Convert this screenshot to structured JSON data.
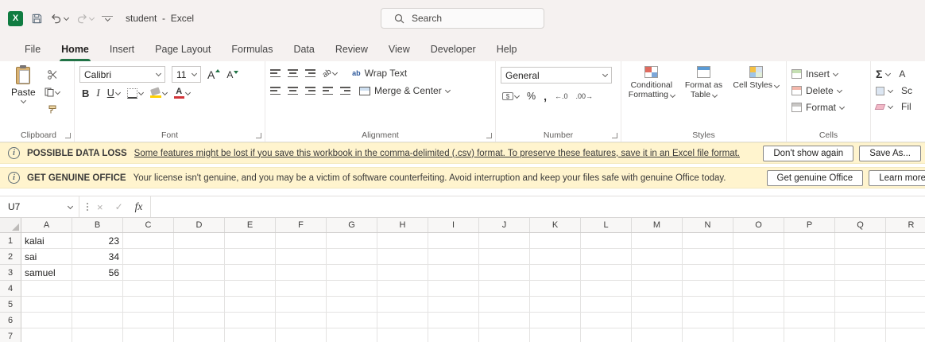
{
  "titlebar": {
    "title": "student  -  Excel",
    "search_placeholder": "Search"
  },
  "tabs": [
    {
      "label": "File"
    },
    {
      "label": "Home",
      "active": true
    },
    {
      "label": "Insert"
    },
    {
      "label": "Page Layout"
    },
    {
      "label": "Formulas"
    },
    {
      "label": "Data"
    },
    {
      "label": "Review"
    },
    {
      "label": "View"
    },
    {
      "label": "Developer"
    },
    {
      "label": "Help"
    }
  ],
  "ribbon": {
    "clipboard": {
      "paste": "Paste",
      "group_label": "Clipboard"
    },
    "font": {
      "family": "Calibri",
      "size": "11",
      "bold": "B",
      "italic": "I",
      "underline": "U",
      "grow": "A",
      "shrink": "A",
      "group_label": "Font"
    },
    "alignment": {
      "orientation_glyph": "ab",
      "wrap_icon_glyph": "ab",
      "wrap": "Wrap Text",
      "merge": "Merge & Center",
      "group_label": "Alignment"
    },
    "number": {
      "format": "General",
      "accounting_glyph": "$",
      "percent": "%",
      "comma": ",",
      "inc_decimal": "←.0",
      "dec_decimal": ".00→",
      "group_label": "Number"
    },
    "styles": {
      "conditional": "Conditional Formatting",
      "format_table": "Format as Table",
      "cell_styles": "Cell Styles",
      "group_label": "Styles"
    },
    "cells": {
      "insert": "Insert",
      "delete": "Delete",
      "format": "Format",
      "group_label": "Cells"
    },
    "editing": {
      "autosum": "Σ",
      "fragment1": "A",
      "fragment2": "Sc",
      "fragment3": "Fil"
    }
  },
  "warnings": [
    {
      "title": "POSSIBLE DATA LOSS",
      "message": "Some features might be lost if you save this workbook in the comma-delimited (.csv) format. To preserve these features, save it in an Excel file format.",
      "buttons": [
        "Don't show again",
        "Save As..."
      ]
    },
    {
      "title": "GET GENUINE OFFICE",
      "message": "Your license isn't genuine, and you may be a victim of software counterfeiting. Avoid interruption and keep your files safe with genuine Office today.",
      "buttons": [
        "Get genuine Office",
        "Learn more"
      ]
    }
  ],
  "formula_bar": {
    "name_box": "U7",
    "cancel": "×",
    "enter": "✓",
    "fx": "fx",
    "value": ""
  },
  "grid": {
    "columns": [
      "A",
      "B",
      "C",
      "D",
      "E",
      "F",
      "G",
      "H",
      "I",
      "J",
      "K",
      "L",
      "M",
      "N",
      "O",
      "P",
      "Q",
      "R"
    ],
    "row_count": 7,
    "cells": [
      {
        "col": "A",
        "row": 1,
        "value": "kalai",
        "align": "left"
      },
      {
        "col": "B",
        "row": 1,
        "value": "23",
        "align": "right"
      },
      {
        "col": "A",
        "row": 2,
        "value": "sai",
        "align": "left"
      },
      {
        "col": "B",
        "row": 2,
        "value": "34",
        "align": "right"
      },
      {
        "col": "A",
        "row": 3,
        "value": "samuel",
        "align": "left"
      },
      {
        "col": "B",
        "row": 3,
        "value": "56",
        "align": "right"
      }
    ]
  },
  "colors": {
    "excel_green": "#107C41",
    "tab_underline": "#217346",
    "warning_bg": "#FFF4CE"
  }
}
